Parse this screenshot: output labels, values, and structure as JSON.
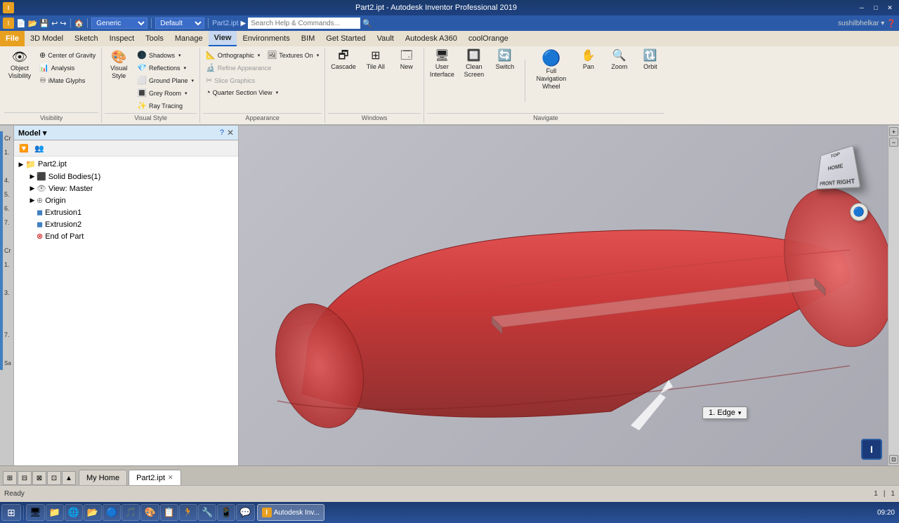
{
  "titlebar": {
    "title": "Part2.ipt - Autodesk Inventor Professional 2019",
    "minimize": "─",
    "maximize": "□",
    "close": "✕"
  },
  "quickaccess": {
    "file_label": "File",
    "profile_label": "Generic",
    "style_label": "Default",
    "filename": "Part2.ipt",
    "search_placeholder": "Search Help & Commands...",
    "user": "sushilbhelkar ▾"
  },
  "menubar": {
    "items": [
      "File",
      "3D Model",
      "Sketch",
      "Inspect",
      "Tools",
      "Manage",
      "View",
      "Environments",
      "BIM",
      "Get Started",
      "Vault",
      "Autodesk A360",
      "coolOrange"
    ]
  },
  "ribbon": {
    "visibility_group": {
      "label": "Visibility",
      "object_visibility": "Object\nVisibility",
      "center_of_gravity": "Center of Gravity",
      "analysis": "Analysis",
      "iMate_glyphs": "iMate Glyphs"
    },
    "visual_style_group": {
      "label": "Visual Style",
      "visual_style": "Visual\nStyle",
      "shadows": "Shadows",
      "reflections": "Reflections",
      "ground_plane": "Ground Plane",
      "grey_room": "Grey Room",
      "ray_tracing": "Ray Tracing"
    },
    "appearance_group": {
      "label": "Appearance",
      "orthographic": "Orthographic",
      "textures_on": "Textures On",
      "refine_appearance": "Refine Appearance",
      "slice_graphics": "Slice Graphics",
      "quarter_section": "Quarter Section View"
    },
    "windows_group": {
      "label": "Windows",
      "cascade": "Cascade",
      "tile_all": "Tile All",
      "new": "New"
    },
    "navigate_group": {
      "label": "Navigate",
      "user_interface": "User\nInterface",
      "clean_screen": "Clean\nScreen",
      "switch": "Switch",
      "full_nav_wheel": "Full Navigation\nWheel",
      "pan": "Pan",
      "zoom": "Zoom",
      "orbit": "Orbit"
    }
  },
  "model_panel": {
    "title": "Model ▾",
    "close": "✕",
    "help": "?",
    "tree": [
      {
        "id": "part2",
        "label": "Part2.ipt",
        "indent": 0,
        "icon": "📁",
        "expand": true
      },
      {
        "id": "solid_bodies",
        "label": "Solid Bodies(1)",
        "indent": 1,
        "icon": "⬜",
        "expand": false
      },
      {
        "id": "view_master",
        "label": "View: Master",
        "indent": 1,
        "icon": "👁",
        "expand": false
      },
      {
        "id": "origin",
        "label": "Origin",
        "indent": 1,
        "icon": "⊕",
        "expand": false
      },
      {
        "id": "extrusion1",
        "label": "Extrusion1",
        "indent": 1,
        "icon": "◼",
        "expand": false
      },
      {
        "id": "extrusion2",
        "label": "Extrusion2",
        "indent": 1,
        "icon": "◼",
        "expand": false
      },
      {
        "id": "end_of_part",
        "label": "End of Part",
        "indent": 1,
        "icon": "⊗",
        "expand": false
      }
    ]
  },
  "viewport": {
    "edge_label": "1. Edge",
    "edge_dropdown": "▾"
  },
  "tabbar": {
    "tabs": [
      {
        "label": "My Home",
        "closeable": false,
        "active": false
      },
      {
        "label": "Part2.ipt",
        "closeable": true,
        "active": true
      }
    ],
    "icons": [
      "⊞",
      "⊟",
      "⊠",
      "⊡",
      "▲"
    ]
  },
  "statusbar": {
    "status": "Ready",
    "coord1": "1",
    "coord2": "1"
  },
  "taskbar": {
    "start": "⊞",
    "apps": [
      "🖥",
      "📁",
      "🌐",
      "📂",
      "🔵",
      "🎵",
      "🎨",
      "📋",
      "🏃",
      "🔧",
      "📱",
      "💬"
    ],
    "time": "09:20",
    "date": ""
  },
  "colors": {
    "accent": "#1a60c0",
    "cylinder": "#d44040",
    "cylinder_shadow": "#a83030",
    "background": "#b0b0b8"
  }
}
